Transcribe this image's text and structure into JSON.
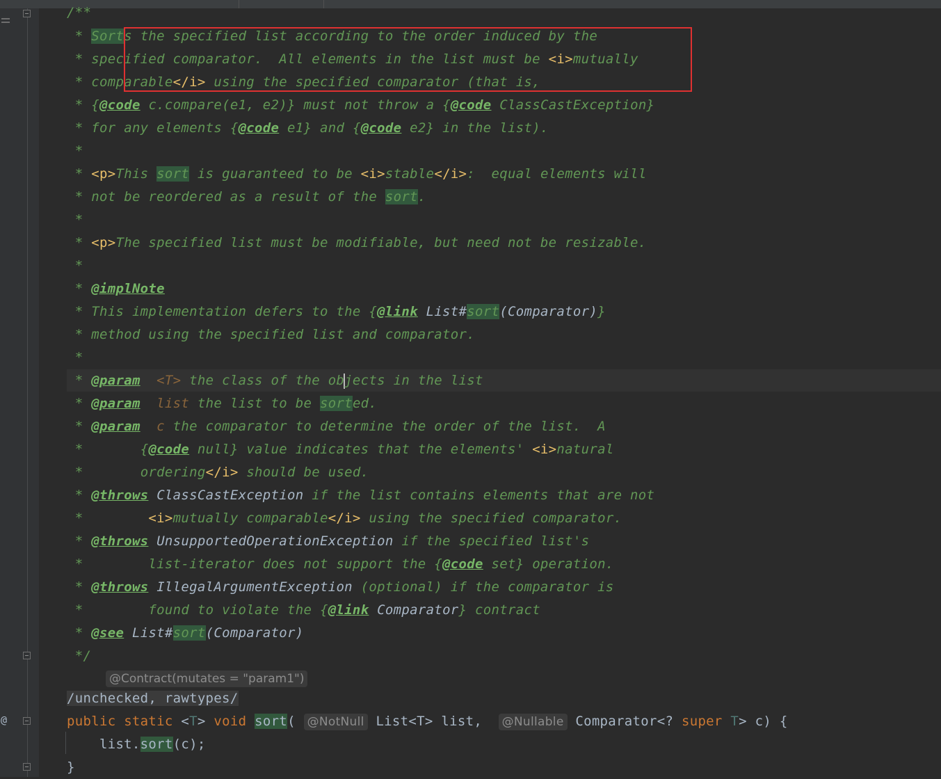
{
  "colors": {
    "background": "#2b2b2b",
    "doc_comment": "#629755",
    "doc_tag": "#77b767",
    "keyword": "#cc7832",
    "search_highlight": "#32593d",
    "annotation_box": "#e03131"
  },
  "icons": [
    "structure-icon",
    "fold-icon",
    "override-icon"
  ],
  "doc": {
    "open": "/**",
    "star": "*",
    "close": "*/",
    "l1": {
      "hl": "Sort",
      "rest": "s the specified list according to the order induced by the"
    },
    "l2": {
      "t1": "specified comparator.  All elements in the list must be ",
      "i": "<i>",
      "t2": "mutually"
    },
    "l3": {
      "t1": "comparable",
      "ie": "</i>",
      "t2": " using the specified comparator (that is,"
    },
    "l4": {
      "b1": "{",
      "tag": "@code",
      "t1": " c.compare(e1, e2)}",
      "t2": " must not throw a ",
      "b2": "{",
      "tag2": "@code",
      "t3": " ClassCastException}"
    },
    "l5": {
      "t1": "for any elements ",
      "b1": "{",
      "tag": "@code",
      "t2": " e1}",
      "t3": " and ",
      "b2": "{",
      "tag2": "@code",
      "t4": " e2}",
      "t5": " in the list)."
    },
    "l7": {
      "p": "<p>",
      "t1": "This ",
      "hl": "sort",
      "t2": " is guaranteed to be ",
      "i": "<i>",
      "t3": "stable",
      "ie": "</i>",
      "t4": ":  equal elements will"
    },
    "l8": {
      "t1": "not be reordered as a result of the ",
      "hl": "sort",
      "t2": "."
    },
    "l10": {
      "p": "<p>",
      "t1": "The specified list must be modifiable, but need not be resizable."
    },
    "l12": {
      "tag": "@implNote"
    },
    "l13": {
      "t1": "This implementation defers to the ",
      "b1": "{",
      "tag": "@link",
      "sp": " ",
      "cls": "List#",
      "hl": "sort",
      "args": "(Comparator)",
      "b2": "}"
    },
    "l14": {
      "t1": "method using the specified list and comparator."
    },
    "l16": {
      "tag": "@param",
      "ref": "<T>",
      "t1": " the class of the ob",
      "t2": "jects in the list"
    },
    "l17": {
      "tag": "@param",
      "ref": "list",
      "t1": " the list to be ",
      "hl": "sort",
      "t2": "ed."
    },
    "l18": {
      "tag": "@param",
      "ref": "c",
      "t1": " the comparator to determine the order of the list.  A"
    },
    "l19": {
      "b1": "{",
      "tag": "@code",
      "t1": " null}",
      "t2": " value indicates that the elements' ",
      "i": "<i>",
      "t3": "natural"
    },
    "l20": {
      "t1": "ordering",
      "ie": "</i>",
      "t2": " should be used."
    },
    "l21": {
      "tag": "@throws",
      "cls": "ClassCastException",
      "t1": " if the list contains elements that are not"
    },
    "l22": {
      "i": "<i>",
      "t1": "mutually comparable",
      "ie": "</i>",
      "t2": " using the specified comparator."
    },
    "l23": {
      "tag": "@throws",
      "cls": "UnsupportedOperationException",
      "t1": " if the specified list's"
    },
    "l24": {
      "t1": "list-iterator does not support the ",
      "b1": "{",
      "tag": "@code",
      "t2": " set}",
      "t3": " operation."
    },
    "l25": {
      "tag": "@throws",
      "cls": "IllegalArgumentException",
      "t1": " (optional) if the comparator is"
    },
    "l26": {
      "t1": "found to violate the ",
      "b1": "{",
      "tag": "@link",
      "sp": " ",
      "cls": "Comparator",
      "b2": "}",
      "t2": " contract"
    },
    "l27": {
      "tag": "@see",
      "sp": " ",
      "cls": "List#",
      "hl": "sort",
      "args": "(Comparator)"
    }
  },
  "code": {
    "contract_hint": "@Contract(mutates = \"param1\")",
    "suppress": "/unchecked, rawtypes/",
    "sig": {
      "public": "public",
      "static": "static",
      "generic_open": "<",
      "T": "T",
      "generic_close": ">",
      "void": "void",
      "name": "sort",
      "paren_open": "(",
      "notnull": "@NotNull",
      "list_type": "List<T>",
      "list_name": "list,",
      "nullable": "@Nullable",
      "comp_type": "Comparator<?",
      "super": "super",
      "T2": "T",
      "rest": "> c) {"
    },
    "body": {
      "recv": "list.",
      "hl": "sort",
      "args": "(c);"
    },
    "closing_brace": "}"
  }
}
